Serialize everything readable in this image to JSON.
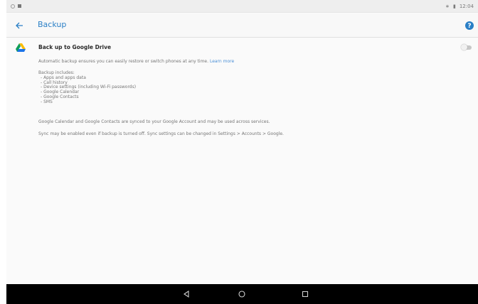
{
  "status_bar": {
    "time": "12:04",
    "icons": [
      "notification-icon",
      "image-icon"
    ],
    "right_icons": [
      "bluetooth-icon",
      "battery-icon"
    ]
  },
  "app_bar": {
    "title": "Backup",
    "back_icon": "arrow-back-icon",
    "help_icon": "help-icon"
  },
  "setting": {
    "title": "Back up to Google Drive",
    "icon": "google-drive-icon",
    "toggle_on": false
  },
  "description": {
    "text": "Automatic backup ensures you can easily restore or switch phones at any time.",
    "learn_more": "Learn more",
    "includes_label": "Backup includes:",
    "includes": [
      "- Apps and apps data",
      "- Call history",
      "- Device settings (including Wi-Fi passwords)",
      "- Google Calendar",
      "- Google Contacts",
      "- SMS"
    ],
    "sync_note": "Google Calendar and Google Contacts are synced to your Google Account and may be used across services.",
    "sync_settings_note": "Sync may be enabled even if backup is turned off. Sync settings can be changed in Settings > Accounts > Google."
  },
  "nav_bar": {
    "buttons": [
      "back-triangle-icon",
      "home-circle-icon",
      "recents-square-icon"
    ]
  },
  "colors": {
    "accent": "#2a7fc6",
    "link": "#4a8fd6",
    "background": "#fafafa",
    "nav": "#000000"
  }
}
